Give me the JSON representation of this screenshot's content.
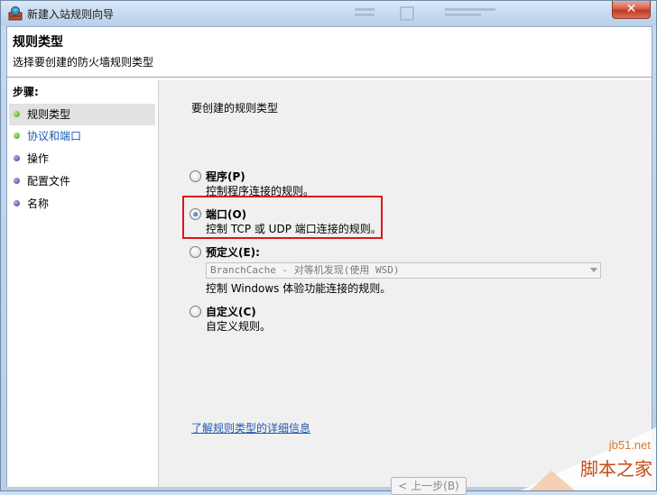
{
  "window": {
    "title": "新建入站规则向导",
    "close_label": "✕"
  },
  "header": {
    "title": "规则类型",
    "subtitle": "选择要创建的防火墙规则类型"
  },
  "sidebar": {
    "heading": "步骤:",
    "items": [
      {
        "label": "规则类型",
        "state": "current",
        "dot": "green"
      },
      {
        "label": "协议和端口",
        "state": "link",
        "dot": "green"
      },
      {
        "label": "操作",
        "state": "normal",
        "dot": "purple"
      },
      {
        "label": "配置文件",
        "state": "normal",
        "dot": "purple"
      },
      {
        "label": "名称",
        "state": "normal",
        "dot": "purple"
      }
    ]
  },
  "main": {
    "prompt": "要创建的规则类型",
    "options": [
      {
        "label": "程序(P)",
        "desc": "控制程序连接的规则。",
        "checked": false
      },
      {
        "label": "端口(O)",
        "desc": "控制 TCP 或 UDP 端口连接的规则。",
        "checked": true
      },
      {
        "label": "预定义(E):",
        "desc": "控制 Windows 体验功能连接的规则。",
        "checked": false
      },
      {
        "label": "自定义(C)",
        "desc": "自定义规则。",
        "checked": false
      }
    ],
    "predefined_select_value": "BranchCache - 对等机发现(使用 WSD)",
    "learn_more_link": "了解规则类型的详细信息",
    "back_button": "< 上一步(B)"
  },
  "watermark": {
    "url": "jb51.net",
    "text": "脚本之家"
  },
  "colors": {
    "highlight": "#e3141a",
    "link": "#1f59b3"
  }
}
